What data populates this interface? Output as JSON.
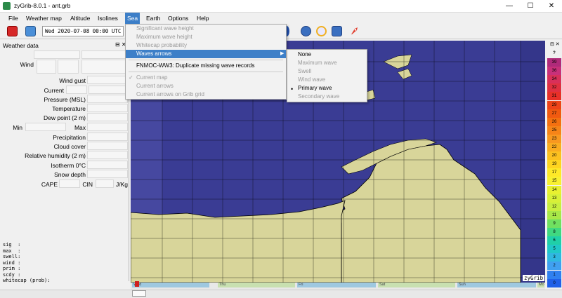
{
  "window": {
    "title": "zyGrib-8.0.1 - ant.grb",
    "minimize": "—",
    "maximize": "☐",
    "close": "✕"
  },
  "menubar": [
    {
      "label": "File"
    },
    {
      "label": "Weather map"
    },
    {
      "label": "Altitude"
    },
    {
      "label": "Isolines"
    },
    {
      "label": "Sea"
    },
    {
      "label": "Earth"
    },
    {
      "label": "Options"
    },
    {
      "label": "Help"
    }
  ],
  "toolbar": {
    "date": "Wed 2020-07-08 00:00 UTC"
  },
  "panel": {
    "title": "Weather data",
    "buttons": "⊟ ✕",
    "wind": "Wind",
    "wind_gust": "Wind gust",
    "current": "Current",
    "pressure": "Pressure (MSL)",
    "temperature": "Temperature",
    "dew_point": "Dew point (2 m)",
    "min": "Min",
    "max": "Max",
    "precipitation": "Precipitation",
    "cloud_cover": "Cloud cover",
    "humidity": "Relative humidity (2 m)",
    "isotherm": "Isotherm 0°C",
    "snow_depth": "Snow depth",
    "cape": "CAPE",
    "cin": "CIN",
    "jkg": "J/Kg",
    "wave_text": "sig  :\nmax  :\nswell:\nwind :\nprim :\nscdy :\nwhitecap (prob):"
  },
  "sea_menu": {
    "items": [
      {
        "label": "Significant wave height",
        "disabled": true
      },
      {
        "label": "Maximum wave height",
        "disabled": true
      },
      {
        "label": "Whitecap probability",
        "disabled": true
      },
      {
        "label": "Waves arrows",
        "highlighted": true
      },
      {
        "label": "FNMOC-WW3: Duplicate missing wave records"
      },
      {
        "label": "Current map",
        "disabled": true
      },
      {
        "label": "Current arrows",
        "disabled": true,
        "checked": true
      },
      {
        "label": "Current arrows on Grib grid",
        "disabled": true
      }
    ],
    "submenu_arrow": "▶",
    "check": "✓"
  },
  "waves_submenu": {
    "items": [
      {
        "label": "None"
      },
      {
        "label": "Maximum wave",
        "disabled": true
      },
      {
        "label": "Swell",
        "disabled": true
      },
      {
        "label": "Wind wave",
        "disabled": true
      },
      {
        "label": "Primary wave",
        "selected": true
      },
      {
        "label": "Secondary wave",
        "disabled": true
      }
    ],
    "bullet": "•"
  },
  "map": {
    "label": "zyGrib",
    "ocean_color": "#3a3c94",
    "land_color": "#d8d59a"
  },
  "colorbar": {
    "title": "?",
    "values": [
      "39",
      "36",
      "34",
      "32",
      "31",
      "29",
      "27",
      "26",
      "25",
      "23",
      "22",
      "20",
      "19",
      "17",
      "15",
      "14",
      "13",
      "12",
      "11",
      "9",
      "8",
      "6",
      "5",
      "3",
      "2",
      "1",
      "0"
    ],
    "colors": [
      "#b02a7a",
      "#c8307a",
      "#d8305a",
      "#e03040",
      "#e83028",
      "#ee4418",
      "#f05a10",
      "#f47010",
      "#f68418",
      "#f89820",
      "#faac20",
      "#fcc020",
      "#fed420",
      "#fee828",
      "#f8f030",
      "#e8f030",
      "#d8f038",
      "#c8ee40",
      "#a8e848",
      "#70e060",
      "#40d880",
      "#20d0a8",
      "#20c8c8",
      "#30b8e0",
      "#40a0f0",
      "#3080f0",
      "#2060e8"
    ]
  },
  "timeline": {
    "days": [
      "Wed",
      "Thu",
      "Fri",
      "Sat",
      "Sun",
      "Mo"
    ]
  }
}
